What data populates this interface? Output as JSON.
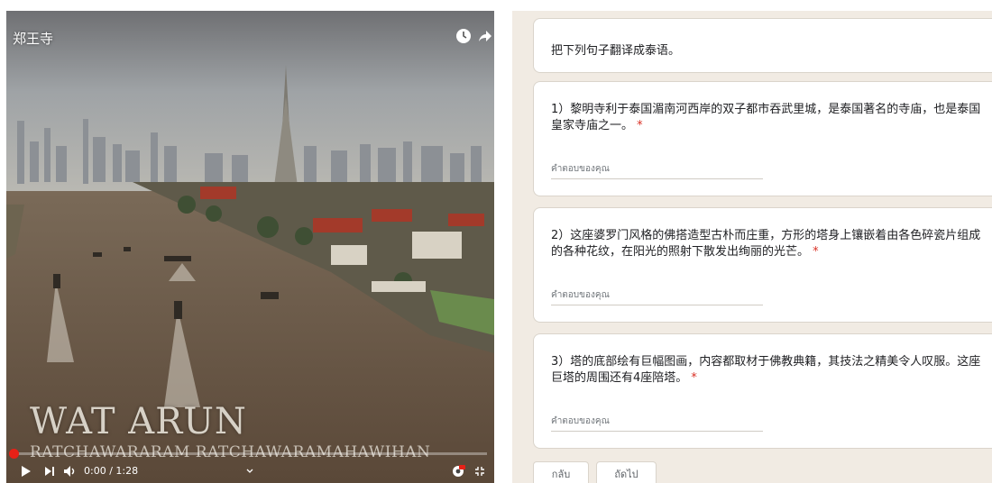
{
  "video": {
    "title": "郑王寺",
    "overlay_title": "Wat Arun",
    "overlay_subtitle": "Ratchawararam Ratchawaramahawihan",
    "time": "0:00 / 1:28",
    "progress_fraction": 0.0,
    "accent_color": "#e62117",
    "icons": [
      "clock-icon",
      "share-icon",
      "play-icon",
      "next-icon",
      "volume-icon",
      "settings-icon",
      "fullscreen-icon"
    ]
  },
  "form": {
    "description": "把下列句子翻译成泰语。",
    "questions": [
      {
        "text": "1）黎明寺利于泰国湄南河西岸的双子都市吞武里城，是泰国著名的寺庙，也是泰国皇家寺庙之一。",
        "required_mark": "*",
        "placeholder": "คำตอบของคุณ"
      },
      {
        "text": "2）这座婆罗门风格的佛搭造型古朴而庄重，方形的塔身上镶嵌着由各色碎瓷片组成的各种花纹，在阳光的照射下散发出绚丽的光芒。",
        "required_mark": "*",
        "placeholder": "คำตอบของคุณ"
      },
      {
        "text": "3）塔的底部绘有巨幅图画，内容都取材于佛教典籍，其技法之精美令人叹服。这座巨塔的周围还有4座陪塔。",
        "required_mark": "*",
        "placeholder": "คำตอบของคุณ"
      }
    ],
    "back_label": "กลับ",
    "next_label": "ถัดไป",
    "background_color": "#f1ebe3",
    "required_color": "#d93025"
  }
}
